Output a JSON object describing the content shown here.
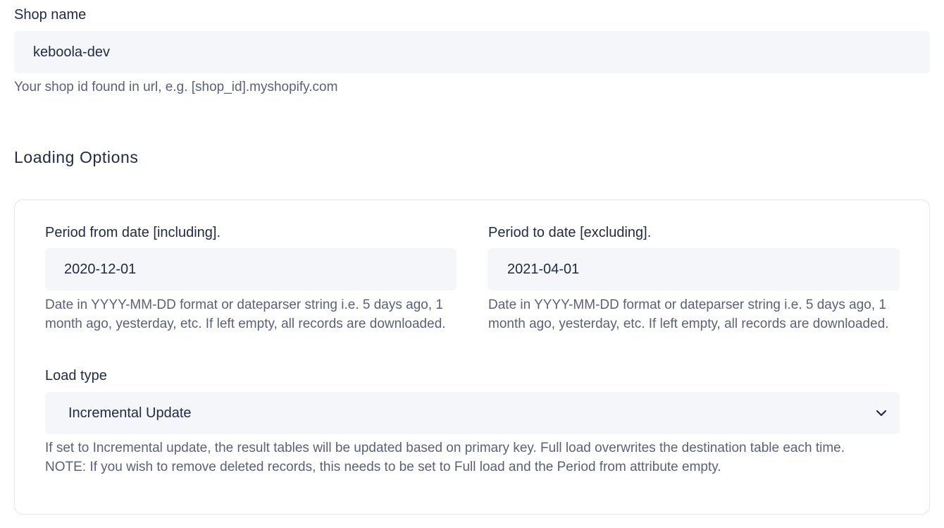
{
  "shop": {
    "label": "Shop name",
    "value": "keboola-dev",
    "help": "Your shop id found in url, e.g. [shop_id].myshopify.com"
  },
  "loading_options": {
    "title": "Loading Options",
    "period_from": {
      "label": "Period from date [including].",
      "value": "2020-12-01",
      "help_line1": "Date in YYYY-MM-DD format or dateparser string i.e. 5 days ago, 1",
      "help_line2": "month ago, yesterday, etc. If left empty, all records are downloaded."
    },
    "period_to": {
      "label": "Period to date [excluding].",
      "value": "2021-04-01",
      "help_line1": "Date in YYYY-MM-DD format or dateparser string i.e. 5 days ago, 1",
      "help_line2": "month ago, yesterday, etc. If left empty, all records are downloaded."
    },
    "load_type": {
      "label": "Load type",
      "selected": "Incremental Update",
      "icon": "chevron-down-icon",
      "help_line1": "If set to Incremental update, the result tables will be updated based on primary key. Full load overwrites the destination table each time.",
      "help_line2": "NOTE: If you wish to remove deleted records, this needs to be set to Full load and the Period from attribute empty."
    }
  }
}
